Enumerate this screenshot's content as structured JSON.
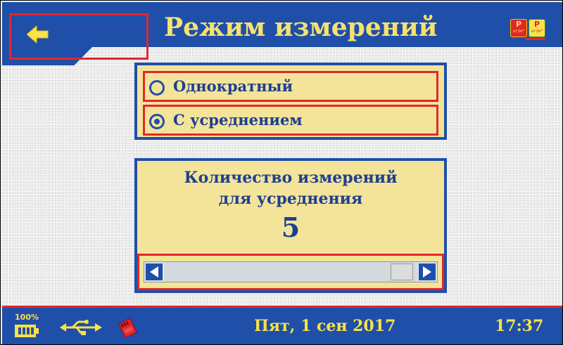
{
  "header": {
    "title": "Режим измерений",
    "back_icon": "arrow-left-icon",
    "unit_icons": [
      {
        "symbol": "P",
        "unit": "кг/м³",
        "icon": "density-unit-icon"
      },
      {
        "symbol": "P",
        "unit": "кг/м³",
        "icon": "density-unit-icon"
      }
    ]
  },
  "mode": {
    "options": [
      {
        "label": "Однократный",
        "selected": false
      },
      {
        "label": "С усреднением",
        "selected": true
      }
    ]
  },
  "averaging": {
    "line1": "Количество измерений",
    "line2": "для усреднения",
    "value": "5",
    "slider_left_icon": "arrow-left-icon",
    "slider_right_icon": "arrow-right-icon"
  },
  "status": {
    "battery_percent": "100%",
    "usb_icon": "usb-icon",
    "sd_icon": "sd-card-icon",
    "date": "Пят, 1 сен 2017",
    "time": "17:37"
  },
  "colors": {
    "header_blue": "#1f4fa8",
    "accent_yellow": "#f7e24a",
    "panel_yellow": "#f3e49a",
    "highlight_red": "#e3262b"
  }
}
